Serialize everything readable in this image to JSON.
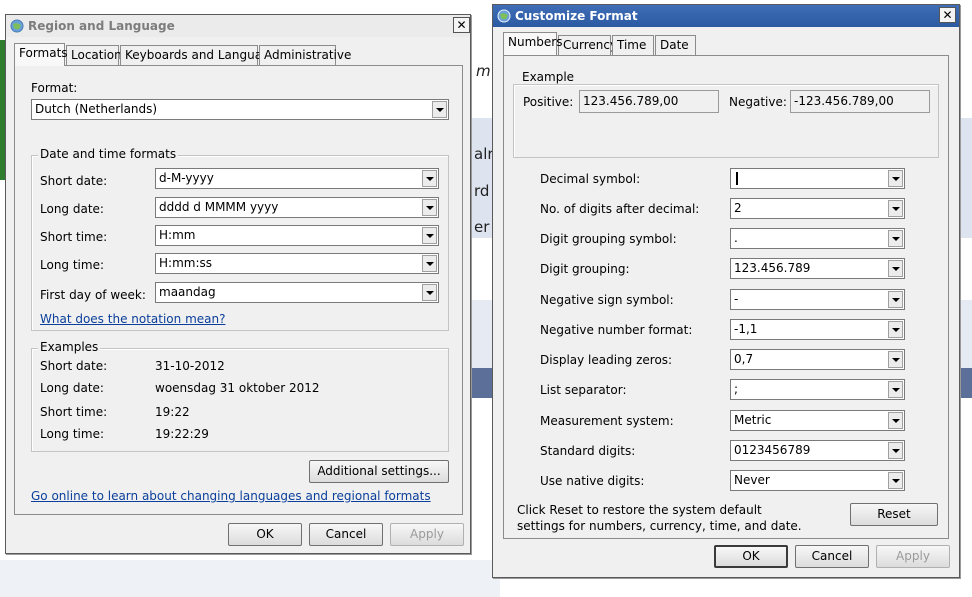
{
  "background": {
    "fragments": [
      "m",
      "alr",
      "rd",
      "er"
    ]
  },
  "region_dialog": {
    "title": "Region and Language",
    "close_glyph": "✕",
    "tabs": [
      "Formats",
      "Location",
      "Keyboards and Languages",
      "Administrative"
    ],
    "format_label": "Format:",
    "format_value": "Dutch (Netherlands)",
    "date_time_group": "Date and time formats",
    "fields": [
      {
        "label": "Short date:",
        "value": "d-M-yyyy"
      },
      {
        "label": "Long date:",
        "value": "dddd d MMMM yyyy"
      },
      {
        "label": "Short time:",
        "value": "H:mm"
      },
      {
        "label": "Long time:",
        "value": "H:mm:ss"
      },
      {
        "label": "First day of week:",
        "value": "maandag"
      }
    ],
    "notation_link": "What does the notation mean?",
    "examples_group": "Examples",
    "examples": [
      {
        "label": "Short date:",
        "value": "31-10-2012"
      },
      {
        "label": "Long date:",
        "value": "woensdag 31 oktober 2012"
      },
      {
        "label": "Short time:",
        "value": "19:22"
      },
      {
        "label": "Long time:",
        "value": "19:22:29"
      }
    ],
    "additional_settings": "Additional settings...",
    "online_link": "Go online to learn about changing languages and regional formats",
    "buttons": {
      "ok": "OK",
      "cancel": "Cancel",
      "apply": "Apply"
    }
  },
  "customize_dialog": {
    "title": "Customize Format",
    "close_glyph": "✕",
    "tabs": [
      "Numbers",
      "Currency",
      "Time",
      "Date"
    ],
    "example_group": "Example",
    "positive_label": "Positive:",
    "positive_value": "123.456.789,00",
    "negative_label": "Negative:",
    "negative_value": "-123.456.789,00",
    "settings": [
      {
        "label": "Decimal symbol:",
        "value": ""
      },
      {
        "label": "No. of digits after decimal:",
        "value": "2"
      },
      {
        "label": "Digit grouping symbol:",
        "value": "."
      },
      {
        "label": "Digit grouping:",
        "value": "123.456.789"
      },
      {
        "label": "Negative sign symbol:",
        "value": "-"
      },
      {
        "label": "Negative number format:",
        "value": "-1,1"
      },
      {
        "label": "Display leading zeros:",
        "value": "0,7"
      },
      {
        "label": "List separator:",
        "value": ";"
      },
      {
        "label": "Measurement system:",
        "value": "Metric"
      },
      {
        "label": "Standard digits:",
        "value": "0123456789"
      },
      {
        "label": "Use native digits:",
        "value": "Never"
      }
    ],
    "reset_info": "Click Reset to restore the system default settings for numbers, currency, time, and date.",
    "reset_button": "Reset",
    "buttons": {
      "ok": "OK",
      "cancel": "Cancel",
      "apply": "Apply"
    }
  }
}
